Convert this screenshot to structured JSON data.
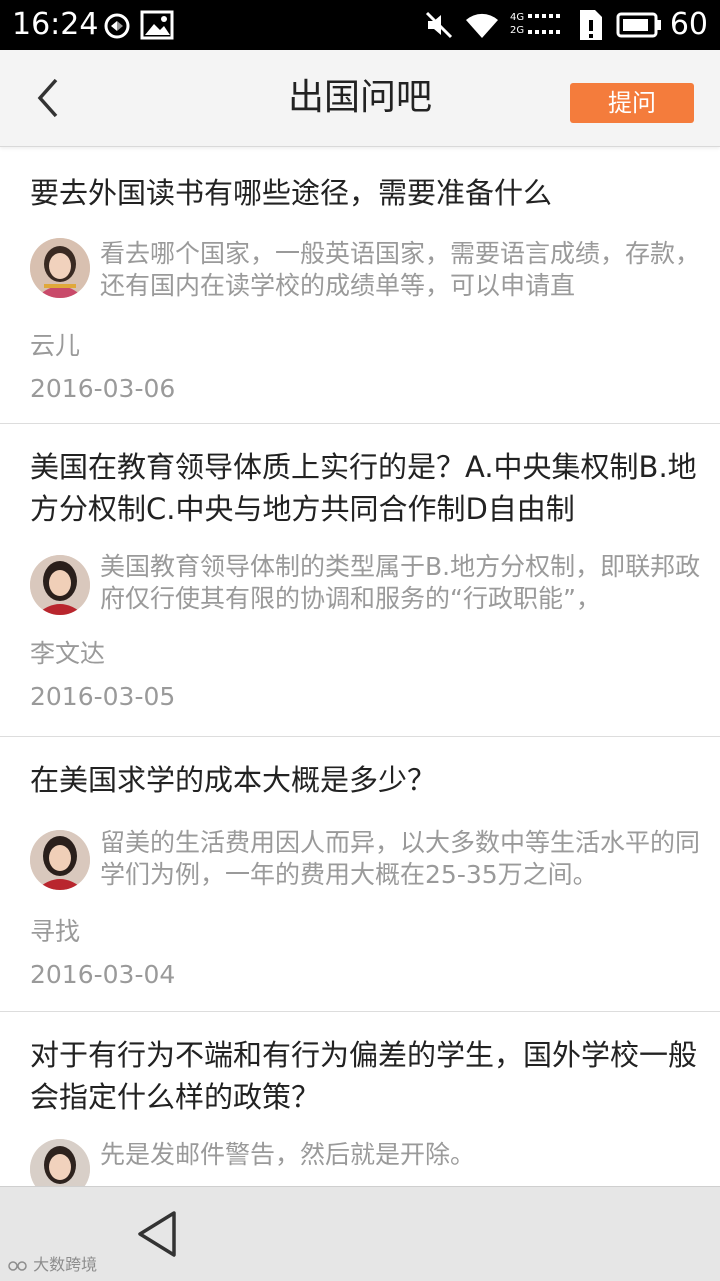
{
  "status_bar": {
    "time": "16:24",
    "battery": "60",
    "icons": [
      "sync-icon",
      "image-icon",
      "mute-icon",
      "wifi-icon",
      "signal-4g-2g-icon",
      "sim-icon",
      "battery-icon"
    ],
    "network_4g": "4G",
    "network_2g": "2G"
  },
  "header": {
    "title": "出国问吧",
    "ask_button": "提问",
    "accent_color": "#f47c3c"
  },
  "questions": [
    {
      "question": "要去外国读书有哪些途径，需要准备什么",
      "answer": "看去哪个国家，一般英语国家，需要语言成绩，存款，还有国内在读学校的成绩单等，可以申请直",
      "author": "云儿",
      "date": "2016-03-06"
    },
    {
      "question": "美国在教育领导体质上实行的是？A.中央集权制B.地方分权制C.中央与地方共同合作制D自由制",
      "answer": "美国教育领导体制的类型属于B.地方分权制，即联邦政府仅行使其有限的协调和服务的“行政职能”，",
      "author": "李文达",
      "date": "2016-03-05"
    },
    {
      "question": "在美国求学的成本大概是多少？",
      "answer": "留美的生活费用因人而异，以大多数中等生活水平的同学们为例，一年的费用大概在25-35万之间。",
      "author": "寻找",
      "date": "2016-03-04"
    },
    {
      "question": "对于有行为不端和有行为偏差的学生，国外学校一般会指定什么样的政策？",
      "answer": "先是发邮件警告，然后就是开除。",
      "author": "",
      "date": ""
    }
  ],
  "nav_bar": {
    "icons": [
      "nav-back-icon"
    ]
  },
  "watermark": "大数跨境"
}
